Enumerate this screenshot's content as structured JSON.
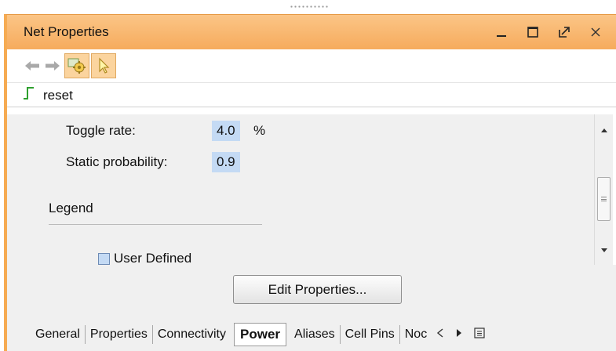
{
  "window": {
    "title": "Net Properties"
  },
  "net": {
    "name": "reset"
  },
  "properties": {
    "toggle_rate_label": "Toggle rate:",
    "toggle_rate_value": "4.0",
    "toggle_rate_unit": "%",
    "static_probability_label": "Static probability:",
    "static_probability_value": "0.9"
  },
  "legend": {
    "title": "Legend",
    "items": [
      {
        "label": "User Defined",
        "color": "#c4daf4"
      }
    ]
  },
  "actions": {
    "edit_properties": "Edit Properties..."
  },
  "tabs": [
    {
      "label": "General",
      "active": false
    },
    {
      "label": "Properties",
      "active": false
    },
    {
      "label": "Connectivity",
      "active": false
    },
    {
      "label": "Power",
      "active": true
    },
    {
      "label": "Aliases",
      "active": false
    },
    {
      "label": "Cell Pins",
      "active": false
    },
    {
      "label": "Noc",
      "active": false
    }
  ],
  "colors": {
    "title_bar": "#f6ab5d",
    "accent_border": "#f6ab52",
    "highlight": "#c4daf4",
    "net_icon": "#2ea02e"
  },
  "icons": [
    "back-arrow-icon",
    "forward-arrow-icon",
    "auto-update-icon",
    "select-pointer-icon",
    "net-signal-icon",
    "minimize-icon",
    "maximize-icon",
    "float-icon",
    "close-icon",
    "tab-scroll-left-icon",
    "tab-scroll-right-icon",
    "tab-list-icon"
  ]
}
